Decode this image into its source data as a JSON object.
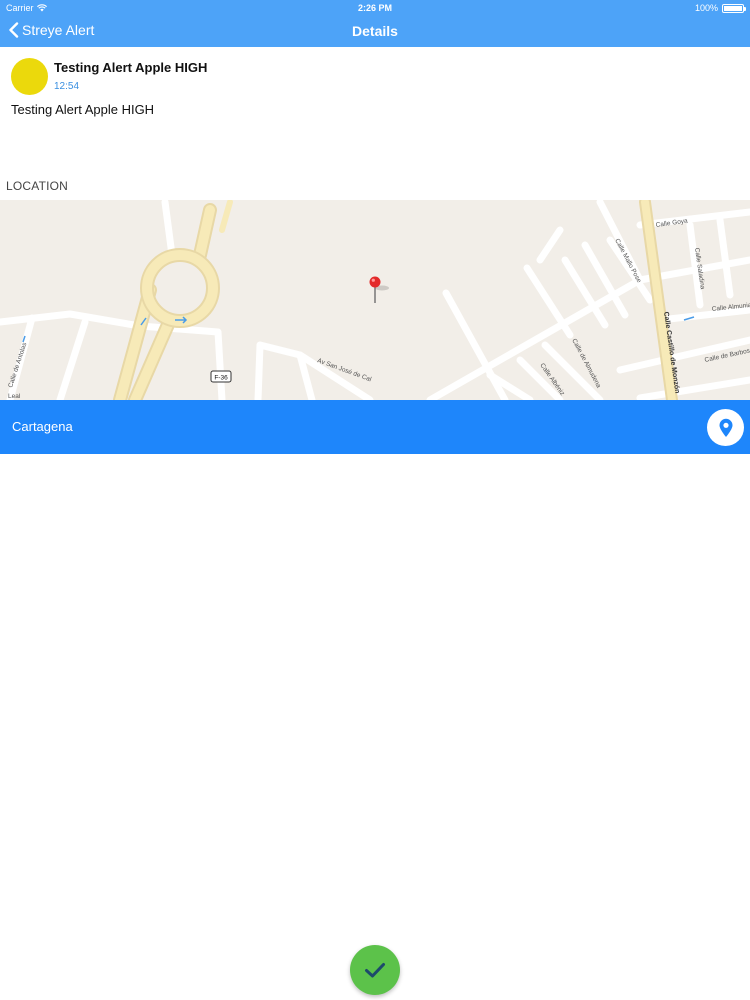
{
  "status_bar": {
    "carrier": "Carrier",
    "time": "2:26 PM",
    "battery": "100%",
    "battery_level": 1.0
  },
  "navbar": {
    "back_label": "Streye Alert",
    "title": "Details"
  },
  "alert": {
    "title": "Testing Alert Apple HIGH",
    "time": "12:54",
    "body": "Testing Alert Apple HIGH",
    "avatar_color": "#ebd90c"
  },
  "location": {
    "section_label": "LOCATION",
    "place_name": "Cartagena",
    "bar_color": "#1e86fb"
  },
  "map": {
    "road_shield": "F-36",
    "streets": {
      "camino_antolas": "Calle de Antolas",
      "av_san_jose": "Av San José de Cal",
      "calle_castillo": "Calle Castillo de Monzón",
      "calle_goya": "Calle Goya",
      "calle_mallo": "Calle Mallo Pose",
      "calle_saladina": "Calle Saladina",
      "calle_almunia": "Calle Almunia",
      "calle_barbosa": "Calle de Barbosa",
      "calle_albeniz": "Calle Albéniz",
      "calle_almudena": "Calle de Almudena",
      "leal": "Leal"
    }
  },
  "actions": {
    "confirm_color": "#5cc24a"
  },
  "icons": {
    "back": "chevron-left-icon",
    "wifi": "wifi-icon",
    "battery": "battery-icon",
    "map_pin": "map-pin-icon",
    "location_pin": "location-pin-icon",
    "check": "checkmark-icon"
  }
}
